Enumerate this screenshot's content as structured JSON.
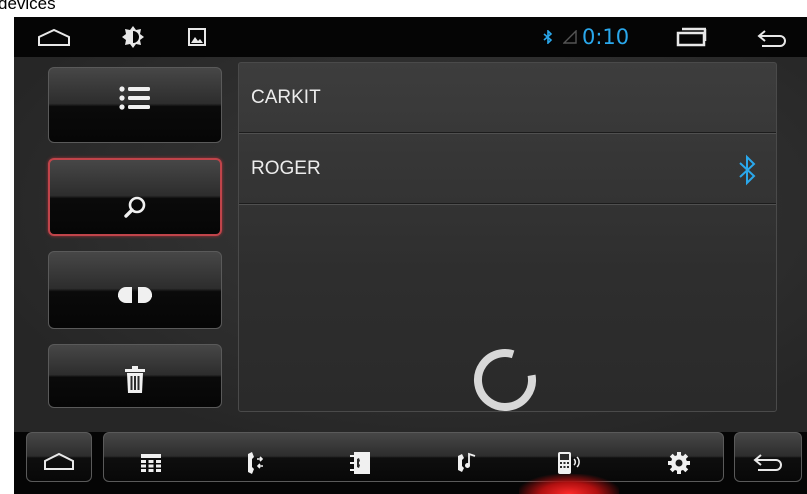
{
  "caption": "devices",
  "status_bar": {
    "time": "0:10",
    "icons": [
      "home-icon",
      "brightness-icon",
      "gallery-icon",
      "bluetooth-icon",
      "signal-icon",
      "recent-apps-icon",
      "back-icon"
    ],
    "accent_color": "#2aa8ec"
  },
  "sidebar": {
    "buttons": [
      {
        "name": "device-list",
        "icon": "list-icon"
      },
      {
        "name": "search",
        "icon": "search-icon",
        "active": true
      },
      {
        "name": "connect",
        "icon": "plug-icon"
      },
      {
        "name": "delete",
        "icon": "trash-icon"
      }
    ],
    "active_border_color": "#c0444a"
  },
  "devices": [
    {
      "name": "CARKIT",
      "connected": false
    },
    {
      "name": "ROGER",
      "connected": true,
      "status_icon": "bluetooth-icon"
    }
  ],
  "loading": true,
  "bottom_nav": {
    "items": [
      "dialpad-icon",
      "call-log-icon",
      "contacts-icon",
      "music-icon",
      "phone-link-icon",
      "settings-icon"
    ],
    "active": "phone-link-icon",
    "active_glow_color": "#ff2a2a"
  }
}
